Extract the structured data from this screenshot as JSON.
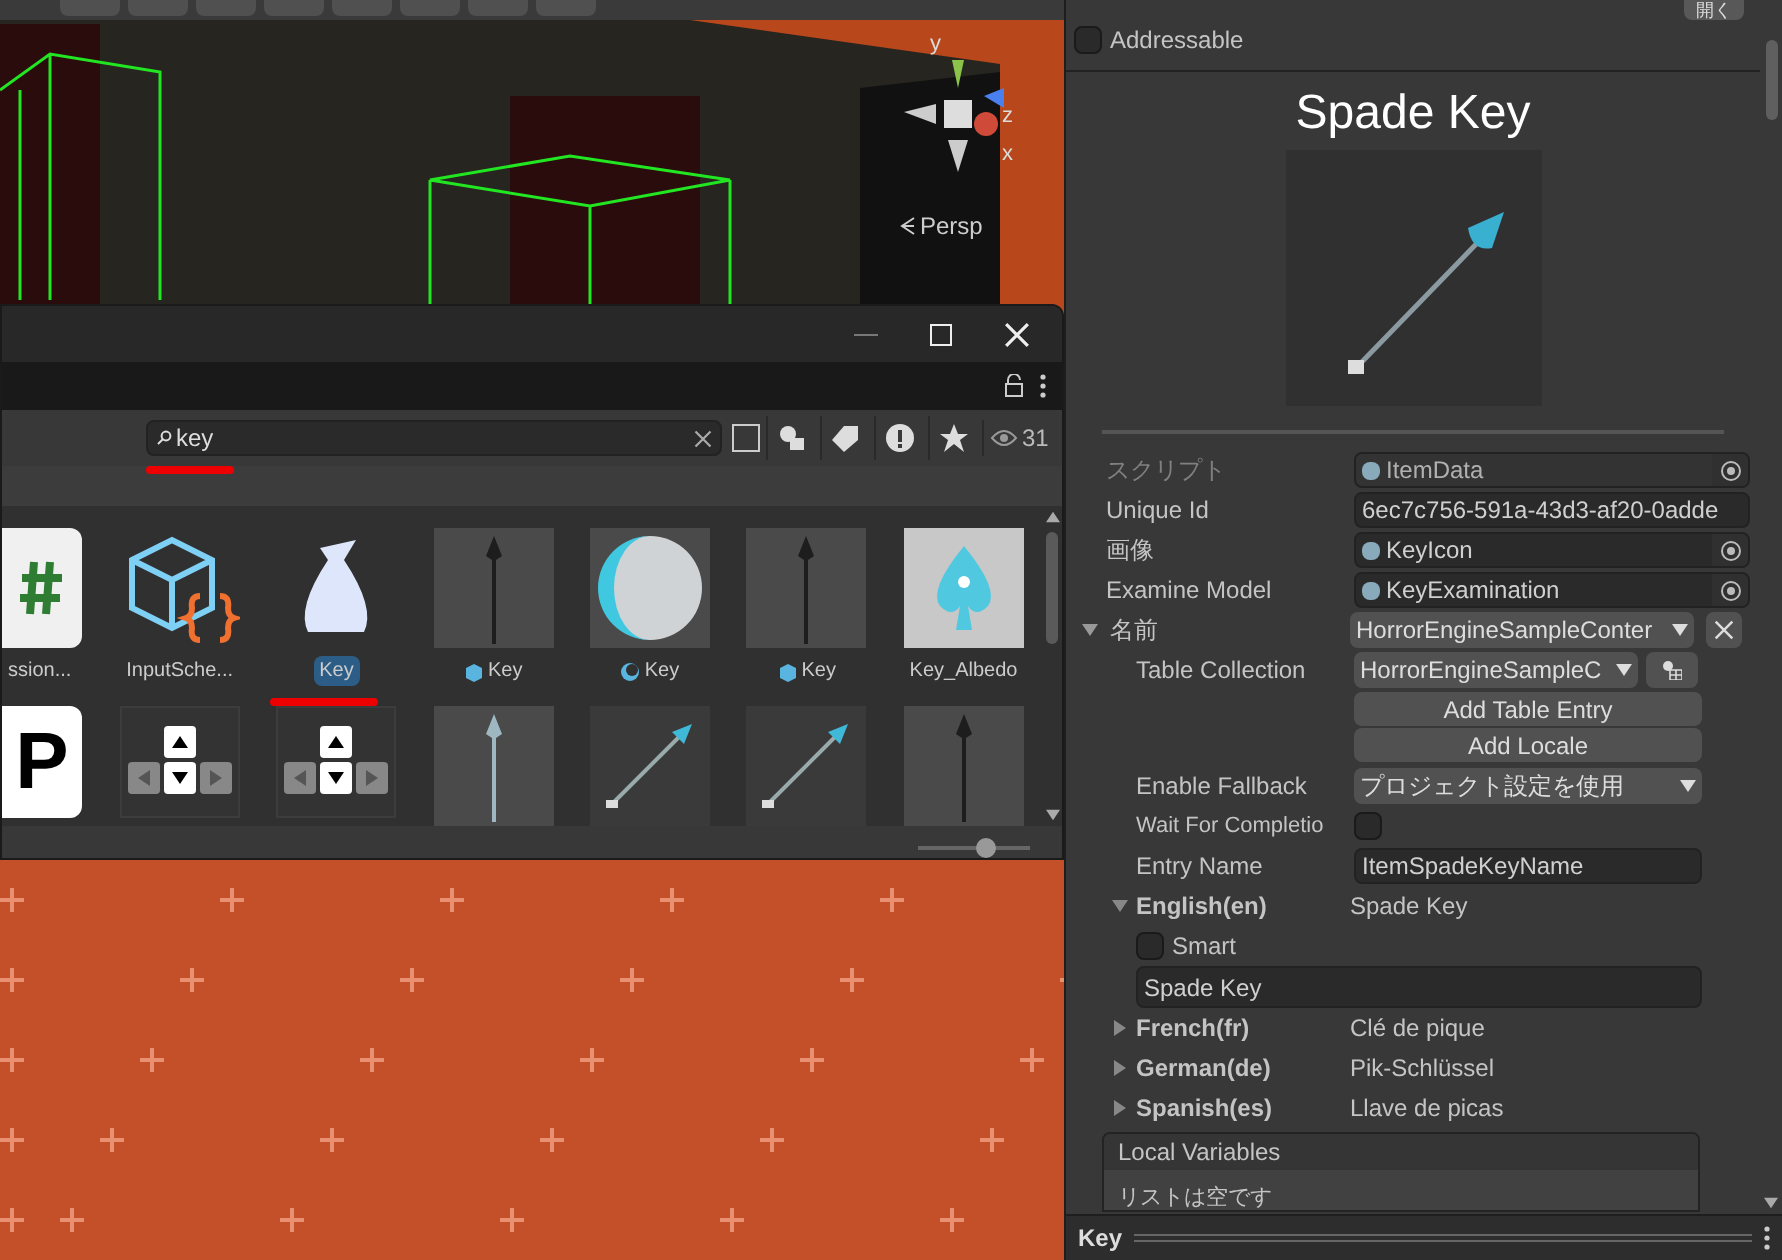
{
  "scene": {
    "view_label": "Persp",
    "axes": [
      "y",
      "z",
      "x"
    ]
  },
  "project_window": {
    "search": {
      "value": "key"
    },
    "visible_count": "31",
    "assets": [
      {
        "label": "ssion...",
        "kind": "script",
        "selected": false
      },
      {
        "label": "InputSche...",
        "kind": "input",
        "selected": false
      },
      {
        "label": "Key",
        "kind": "item",
        "selected": true
      },
      {
        "label": "Key",
        "kind": "mesh",
        "selected": false
      },
      {
        "label": "Key",
        "kind": "material",
        "selected": false
      },
      {
        "label": "Key",
        "kind": "mesh",
        "selected": false
      },
      {
        "label": "Key_Albedo",
        "kind": "texture",
        "selected": false
      }
    ],
    "assets_row_2": [
      {
        "kind": "font",
        "glyph": "P"
      },
      {
        "kind": "arrows"
      },
      {
        "kind": "arrows"
      },
      {
        "kind": "spear"
      },
      {
        "kind": "key"
      },
      {
        "kind": "key"
      },
      {
        "kind": "dark"
      }
    ],
    "zoom": {
      "level": 0.6
    }
  },
  "inspector": {
    "open_button": "開く",
    "addressable": {
      "label": "Addressable",
      "checked": false
    },
    "title": "Spade Key",
    "fields": [
      {
        "label": "スクリプト",
        "value": "ItemData",
        "kind": "object",
        "disabled": true
      },
      {
        "label": "Unique Id",
        "value": "6ec7c756-591a-43d3-af20-0adde",
        "kind": "text",
        "disabled": false
      },
      {
        "label": "画像",
        "value": "KeyIcon",
        "kind": "object",
        "disabled": false
      },
      {
        "label": "Examine Model",
        "value": "KeyExamination",
        "kind": "object",
        "disabled": false
      }
    ],
    "localized": {
      "label": "名前",
      "expanded": true,
      "table": "HorrorEngineSampleConter",
      "table_collection": {
        "label": "Table Collection",
        "value": "HorrorEngineSampleC"
      },
      "buttons": [
        "Add Table Entry",
        "Add Locale"
      ],
      "enable_fallback": {
        "label": "Enable Fallback",
        "value": "プロジェクト設定を使用"
      },
      "wait": {
        "label": "Wait For Completio",
        "checked": false
      },
      "entry_name": {
        "label": "Entry Name",
        "value": "ItemSpadeKeyName"
      },
      "locales": [
        {
          "name": "English(en)",
          "value": "Spade Key",
          "expanded": true,
          "smart": {
            "label": "Smart",
            "checked": false
          },
          "text": "Spade Key"
        },
        {
          "name": "French(fr)",
          "value": "Clé de pique",
          "expanded": false
        },
        {
          "name": "German(de)",
          "value": "Pik-Schlüssel",
          "expanded": false
        },
        {
          "name": "Spanish(es)",
          "value": "Llave de picas",
          "expanded": false
        }
      ],
      "local_variables": {
        "title": "Local Variables",
        "empty": "リストは空です"
      }
    },
    "footer": "Key"
  }
}
